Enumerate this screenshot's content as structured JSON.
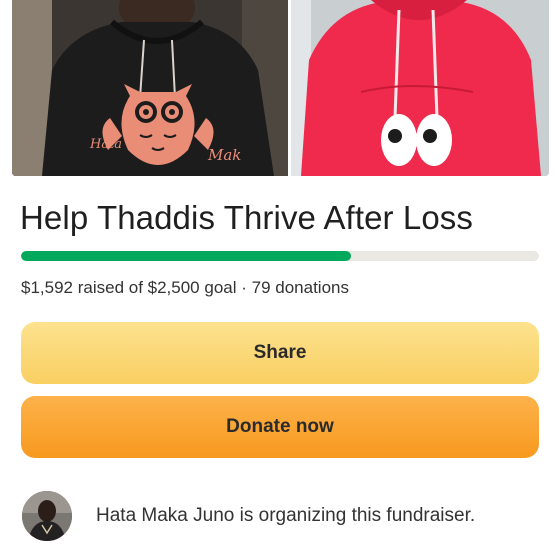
{
  "campaign": {
    "title": "Help Thaddis Thrive After Loss",
    "raised": "$1,592",
    "goal": "$2,500",
    "donations": "79",
    "stats_text": "$1,592 raised of $2,500 goal · 79 donations",
    "progress_fraction": 0.637
  },
  "hero": {
    "left_photo_hoodie_text_left": "Hata",
    "left_photo_hoodie_text_right": "Mak"
  },
  "actions": {
    "share_label": "Share",
    "donate_label": "Donate now"
  },
  "organizer": {
    "text": "Hata Maka Juno is organizing this fundraiser."
  },
  "colors": {
    "progress": "#02a95c",
    "share_button": "#fbd773",
    "donate_button": "#f9a532",
    "track": "#e9e8e2"
  }
}
